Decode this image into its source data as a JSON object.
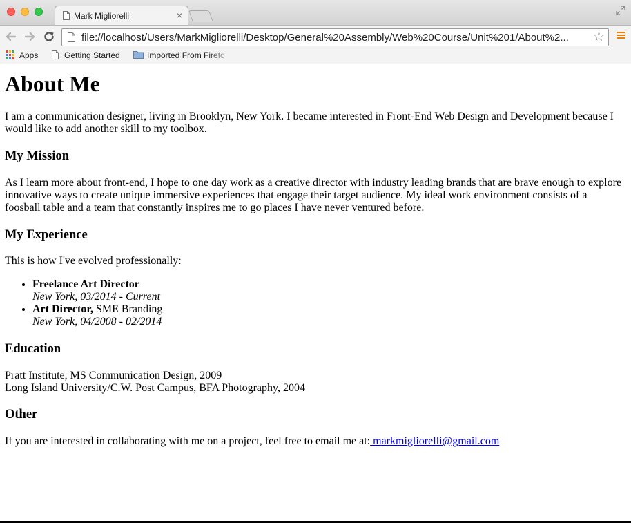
{
  "browser": {
    "tab_title": "Mark Migliorelli",
    "tab_close": "×",
    "url": "file://localhost/Users/MarkMigliorelli/Desktop/General%20Assembly/Web%20Course/Unit%201/About%2...",
    "star": "☆",
    "bookmarks": [
      {
        "label": "Apps",
        "icon": "apps-grid-icon"
      },
      {
        "label": "Getting Started",
        "icon": "page-icon"
      },
      {
        "label": "Imported From Firefo",
        "icon": "folder-icon"
      }
    ]
  },
  "page": {
    "title": "About Me",
    "intro": "I am a communication designer, living in Brooklyn, New York. I became interested in Front-End Web Design and Development because I would like to add another skill to my toolbox.",
    "mission": {
      "heading": "My Mission",
      "text": "As I learn more about front-end, I hope to one day work as a creative director with industry leading brands that are brave enough to explore innovative ways to create unique immersive experiences that engage their target audience. My ideal work environment consists of a foosball table and a team that constantly inspires me to go places I have never ventured before."
    },
    "experience": {
      "heading": "My Experience",
      "intro": "This is how I've evolved professionally:",
      "jobs": [
        {
          "title": "Freelance Art Director",
          "company": "",
          "meta": "New York, 03/2014 - Current"
        },
        {
          "title": "Art Director,",
          "company": " SME Branding",
          "meta": "New York, 04/2008 - 02/2014"
        }
      ]
    },
    "education": {
      "heading": "Education",
      "items": [
        "Pratt Institute, MS Communication Design, 2009",
        "Long Island University/C.W. Post Campus, BFA Photography, 2004"
      ]
    },
    "other": {
      "heading": "Other",
      "text": "If you are interested in collaborating with me on a project, feel free to email me at:",
      "email": " markmigliorelli@gmail.com"
    }
  },
  "colors": {
    "link": "#0000ee",
    "menu_accent": "#e8820c"
  }
}
